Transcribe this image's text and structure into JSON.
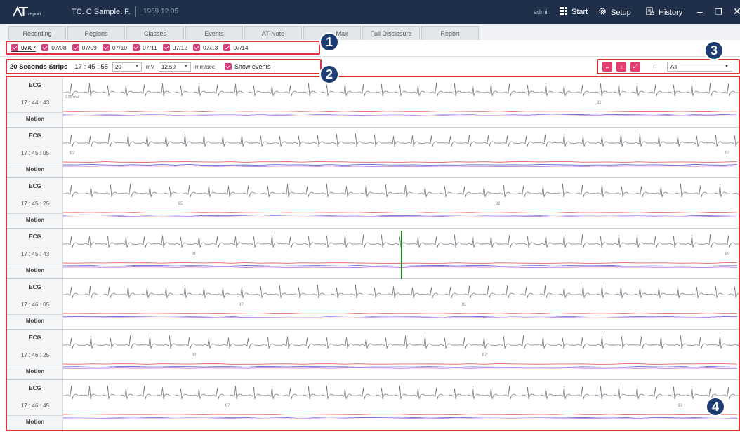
{
  "app": {
    "logo_sub": "report",
    "patient": "TC. C Sample. F.",
    "dob": "1959.12.05",
    "user": "admin",
    "buttons": {
      "start": "Start",
      "setup": "Setup",
      "history": "History"
    }
  },
  "tabs": [
    {
      "label": "Recording",
      "state": "disabled"
    },
    {
      "label": "Regions",
      "state": "normal"
    },
    {
      "label": "Classes",
      "state": "normal"
    },
    {
      "label": "Events",
      "state": "normal"
    },
    {
      "label": "AT-Note",
      "state": "normal"
    },
    {
      "label": "Max",
      "state": "normal"
    },
    {
      "label": "Full Disclosure",
      "state": "active"
    },
    {
      "label": "Report",
      "state": "normal"
    }
  ],
  "dates": [
    "07/07",
    "07/08",
    "07/09",
    "07/10",
    "07/11",
    "07/12",
    "07/13",
    "07/14"
  ],
  "controls": {
    "title": "20 Seconds Strips",
    "time": "17 : 45 : 55",
    "gain": "20",
    "gain_unit": "mV",
    "speed": "12.50",
    "speed_unit": "mm/sec",
    "show_events": "Show events",
    "filter": "All"
  },
  "badges": [
    "1",
    "2",
    "3",
    "4"
  ],
  "scale_label": "0.25 mV",
  "strips": [
    {
      "lead": "ECG",
      "time": "17 : 44 : 43",
      "motion": "Motion",
      "marks": [
        {
          "pos": 0.79,
          "text": "81"
        }
      ]
    },
    {
      "lead": "ECG",
      "time": "17 : 45 : 05",
      "motion": "Motion",
      "marks": [
        {
          "pos": 0.01,
          "text": "82"
        },
        {
          "pos": 0.98,
          "text": "93"
        }
      ]
    },
    {
      "lead": "ECG",
      "time": "17 : 45 : 25",
      "motion": "Motion",
      "marks": [
        {
          "pos": 0.17,
          "text": "95"
        },
        {
          "pos": 0.64,
          "text": "92"
        }
      ]
    },
    {
      "lead": "ECG",
      "time": "17 : 45 : 43",
      "motion": "Motion",
      "marks": [
        {
          "pos": 0.19,
          "text": "91"
        },
        {
          "pos": 0.98,
          "text": "89"
        }
      ]
    },
    {
      "lead": "ECG",
      "time": "17 : 46 : 05",
      "motion": "Motion",
      "marks": [
        {
          "pos": 0.26,
          "text": "87"
        },
        {
          "pos": 0.59,
          "text": "91"
        }
      ]
    },
    {
      "lead": "ECG",
      "time": "17 : 46 : 25",
      "motion": "Motion",
      "marks": [
        {
          "pos": 0.19,
          "text": "93"
        },
        {
          "pos": 0.62,
          "text": "87"
        }
      ]
    },
    {
      "lead": "ECG",
      "time": "17 : 46 : 45",
      "motion": "Motion",
      "marks": [
        {
          "pos": 0.24,
          "text": "87"
        },
        {
          "pos": 0.91,
          "text": "93"
        }
      ]
    }
  ],
  "colors": {
    "accent": "#e43d6f",
    "highlight": "#e0303a",
    "badge": "#1d3d72",
    "titlebar": "#1f2f4a",
    "marker": "#1a8a1a"
  }
}
